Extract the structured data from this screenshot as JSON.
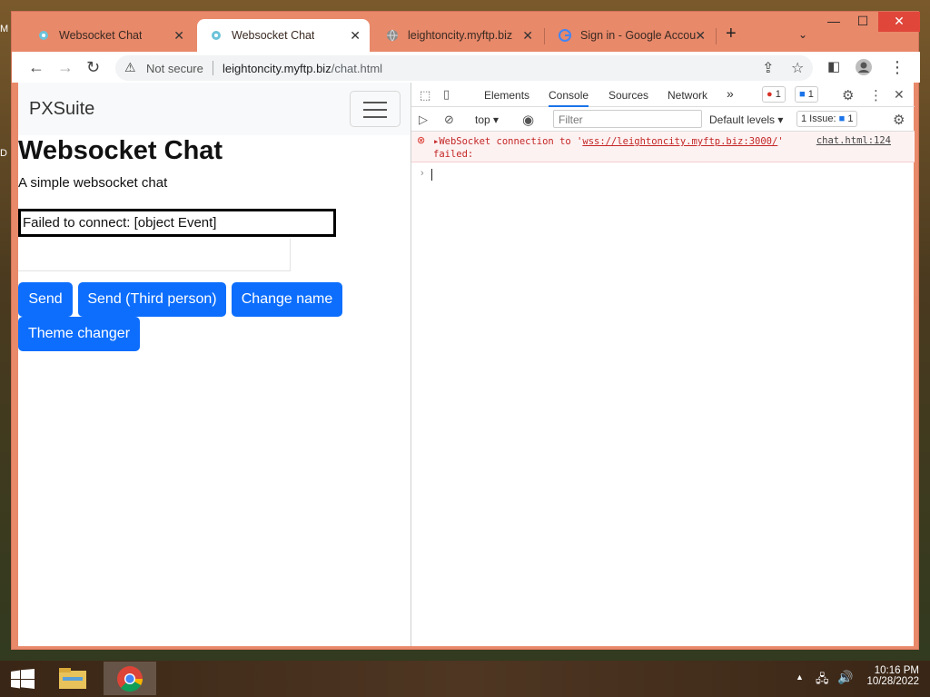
{
  "desktop": {
    "edge_top": "M",
    "edge_mid": "D"
  },
  "browser": {
    "tabs": [
      {
        "title": "Websocket Chat",
        "active": false
      },
      {
        "title": "Websocket Chat",
        "active": true
      },
      {
        "title": "leightoncity.myftp.biz",
        "active": false
      },
      {
        "title": "Sign in - Google Accou",
        "active": false
      }
    ],
    "new_tab": "+",
    "omnibox": {
      "security": "Not secure",
      "host": "leightoncity.myftp.biz",
      "path": "/chat.html"
    }
  },
  "page": {
    "brand": "PXSuite",
    "heading": "Websocket Chat",
    "subtitle": "A simple websocket chat",
    "log_text": "Failed to connect: [object Event]",
    "buttons": {
      "send": "Send",
      "send_third": "Send (Third person)",
      "change_name": "Change name",
      "theme": "Theme changer"
    }
  },
  "devtools": {
    "tabs": [
      "Elements",
      "Console",
      "Sources",
      "Network"
    ],
    "more": "»",
    "error_count": "1",
    "message_count": "1",
    "context": "top",
    "filter_placeholder": "Filter",
    "levels": "Default levels",
    "issues_label": "1 Issue:",
    "issues_count": "1",
    "error": {
      "prefix": "WebSocket connection to '",
      "url": "wss://leightoncity.myftp.biz:3000/",
      "suffix": "'",
      "line2": "failed:",
      "source": "chat.html:124"
    }
  },
  "taskbar": {
    "time": "10:16 PM",
    "date": "10/28/2022"
  },
  "colors": {
    "primary_button": "#0d6efd",
    "window_frame": "#e8896a",
    "error_text": "#c42626"
  }
}
